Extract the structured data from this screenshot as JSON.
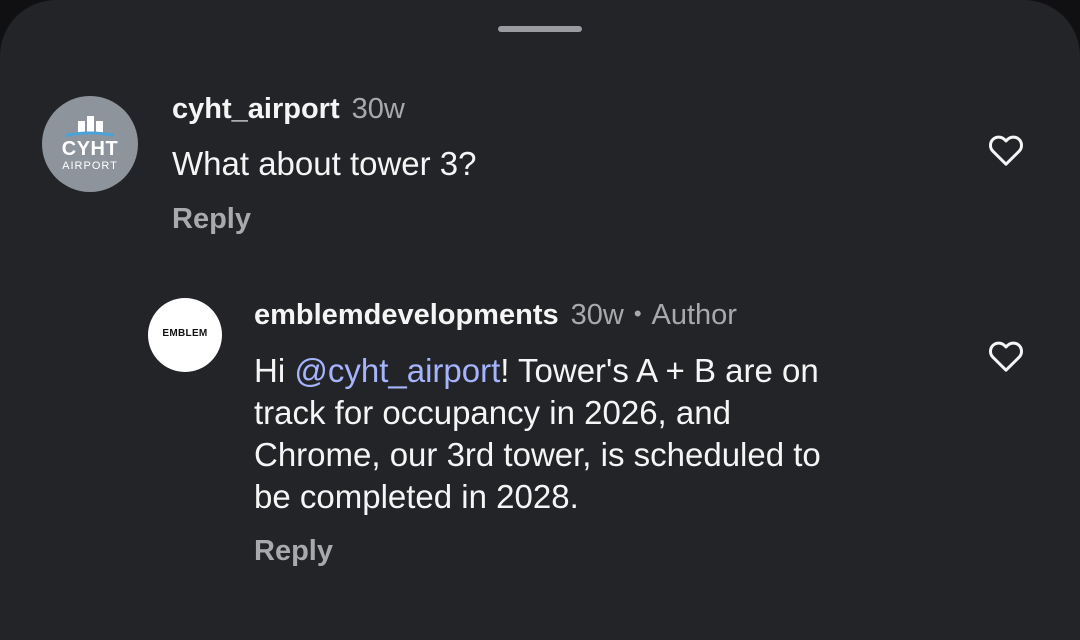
{
  "comments": [
    {
      "username": "cyht_airport",
      "time": "30w",
      "text": "What about tower 3?",
      "reply_label": "Reply",
      "avatar": {
        "word": "CYHT",
        "sub": "AIRPORT"
      },
      "like_icon": "heart-outline-icon"
    },
    {
      "username": "emblemdevelopments",
      "time": "30w",
      "separator": "•",
      "author_badge": "Author",
      "mention": "@cyht_airport",
      "text_line1_rest": "! Tower's A + B are on",
      "text_greeting": "Hi ",
      "text_line2": "track for occupancy in 2026, and",
      "text_line3": "Chrome, our 3rd tower, is scheduled to",
      "text_line4": "be completed in 2028.",
      "reply_label": "Reply",
      "avatar": {
        "word": "EMBLEM"
      },
      "like_icon": "heart-outline-icon"
    }
  ],
  "colors": {
    "sheet": "#232428",
    "text": "#f5f5f5",
    "muted": "#a8a9ad",
    "mention": "#a5b4fc"
  }
}
